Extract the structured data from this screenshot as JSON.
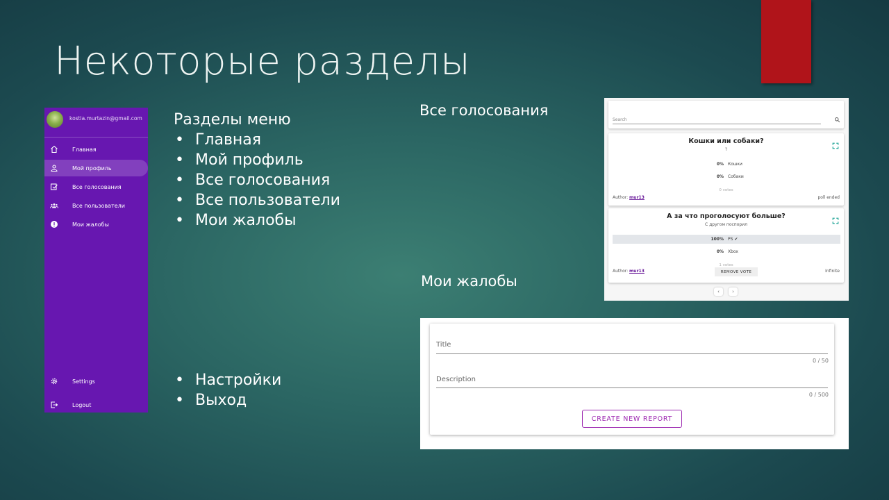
{
  "slide": {
    "title": "Некоторые разделы",
    "accent_color": "#b0141a"
  },
  "sidebar": {
    "email": "kostia.murtazin@gmail.com",
    "bg_color": "#6717b0",
    "items": [
      {
        "label": "Главная",
        "icon": "home-icon"
      },
      {
        "label": "Мой профиль",
        "icon": "person-icon",
        "active": true
      },
      {
        "label": "Все голосования",
        "icon": "poll-icon"
      },
      {
        "label": "Все пользователи",
        "icon": "users-icon"
      },
      {
        "label": "Мои жалобы",
        "icon": "alert-icon"
      }
    ],
    "bottom_items": [
      {
        "label": "Settings",
        "icon": "gear-icon"
      },
      {
        "label": "Logout",
        "icon": "logout-icon"
      }
    ]
  },
  "menu_sections": {
    "heading": "Разделы меню",
    "items": [
      "Главная",
      "Мой профиль",
      "Все голосования",
      "Все пользователи",
      "Мои жалобы"
    ],
    "bottom_items": [
      "Настройки",
      "Выход"
    ]
  },
  "labels": {
    "all_polls": "Все голосования",
    "my_reports": "Мои жалобы"
  },
  "polls_screen": {
    "search_placeholder": "Search",
    "polls": [
      {
        "title": "Кошки или собаки?",
        "subtitle": "?",
        "options": [
          {
            "percent": "0%",
            "label": "Кошки"
          },
          {
            "percent": "0%",
            "label": "Собаки"
          }
        ],
        "votes": "0 votes",
        "author_prefix": "Author:",
        "author": "mur13",
        "status": "poll ended"
      },
      {
        "title": "А за что проголосуют больше?",
        "subtitle": "С другом поспорил",
        "options": [
          {
            "percent": "100%",
            "label": "PS ✔",
            "selected": true
          },
          {
            "percent": "0%",
            "label": "Xbox"
          }
        ],
        "votes": "1 votes",
        "author_prefix": "Author:",
        "author": "mur13",
        "status": "Infinite",
        "remove_vote_label": "REMOVE VOTE"
      }
    ],
    "pager_prev": "‹",
    "pager_next": "›"
  },
  "report_form": {
    "title_label": "Title",
    "title_counter": "0 / 50",
    "description_label": "Description",
    "description_counter": "0 / 500",
    "create_button": "CREATE NEW REPORT",
    "accent_color": "#9c27b0"
  }
}
